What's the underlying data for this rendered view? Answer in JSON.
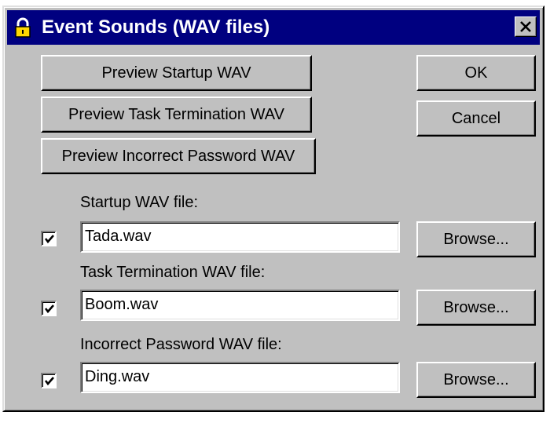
{
  "window": {
    "title": "Event Sounds (WAV files)",
    "title_bar_color": "#000080",
    "face_color": "#c0c0c0"
  },
  "buttons": {
    "preview_startup": "Preview Startup WAV",
    "preview_task_termination": "Preview Task Termination WAV",
    "preview_incorrect_password": "Preview Incorrect Password WAV",
    "ok": "OK",
    "cancel": "Cancel"
  },
  "fields": [
    {
      "label": "Startup WAV file:",
      "value": "Tada.wav",
      "checked": true,
      "browse": "Browse..."
    },
    {
      "label": "Task Termination WAV file:",
      "value": "Boom.wav",
      "checked": true,
      "browse": "Browse..."
    },
    {
      "label": "Incorrect Password WAV file:",
      "value": "Ding.wav",
      "checked": true,
      "browse": "Browse..."
    }
  ],
  "icons": {
    "title": "padlock-icon",
    "close": "close-icon",
    "check": "checkmark-icon"
  }
}
